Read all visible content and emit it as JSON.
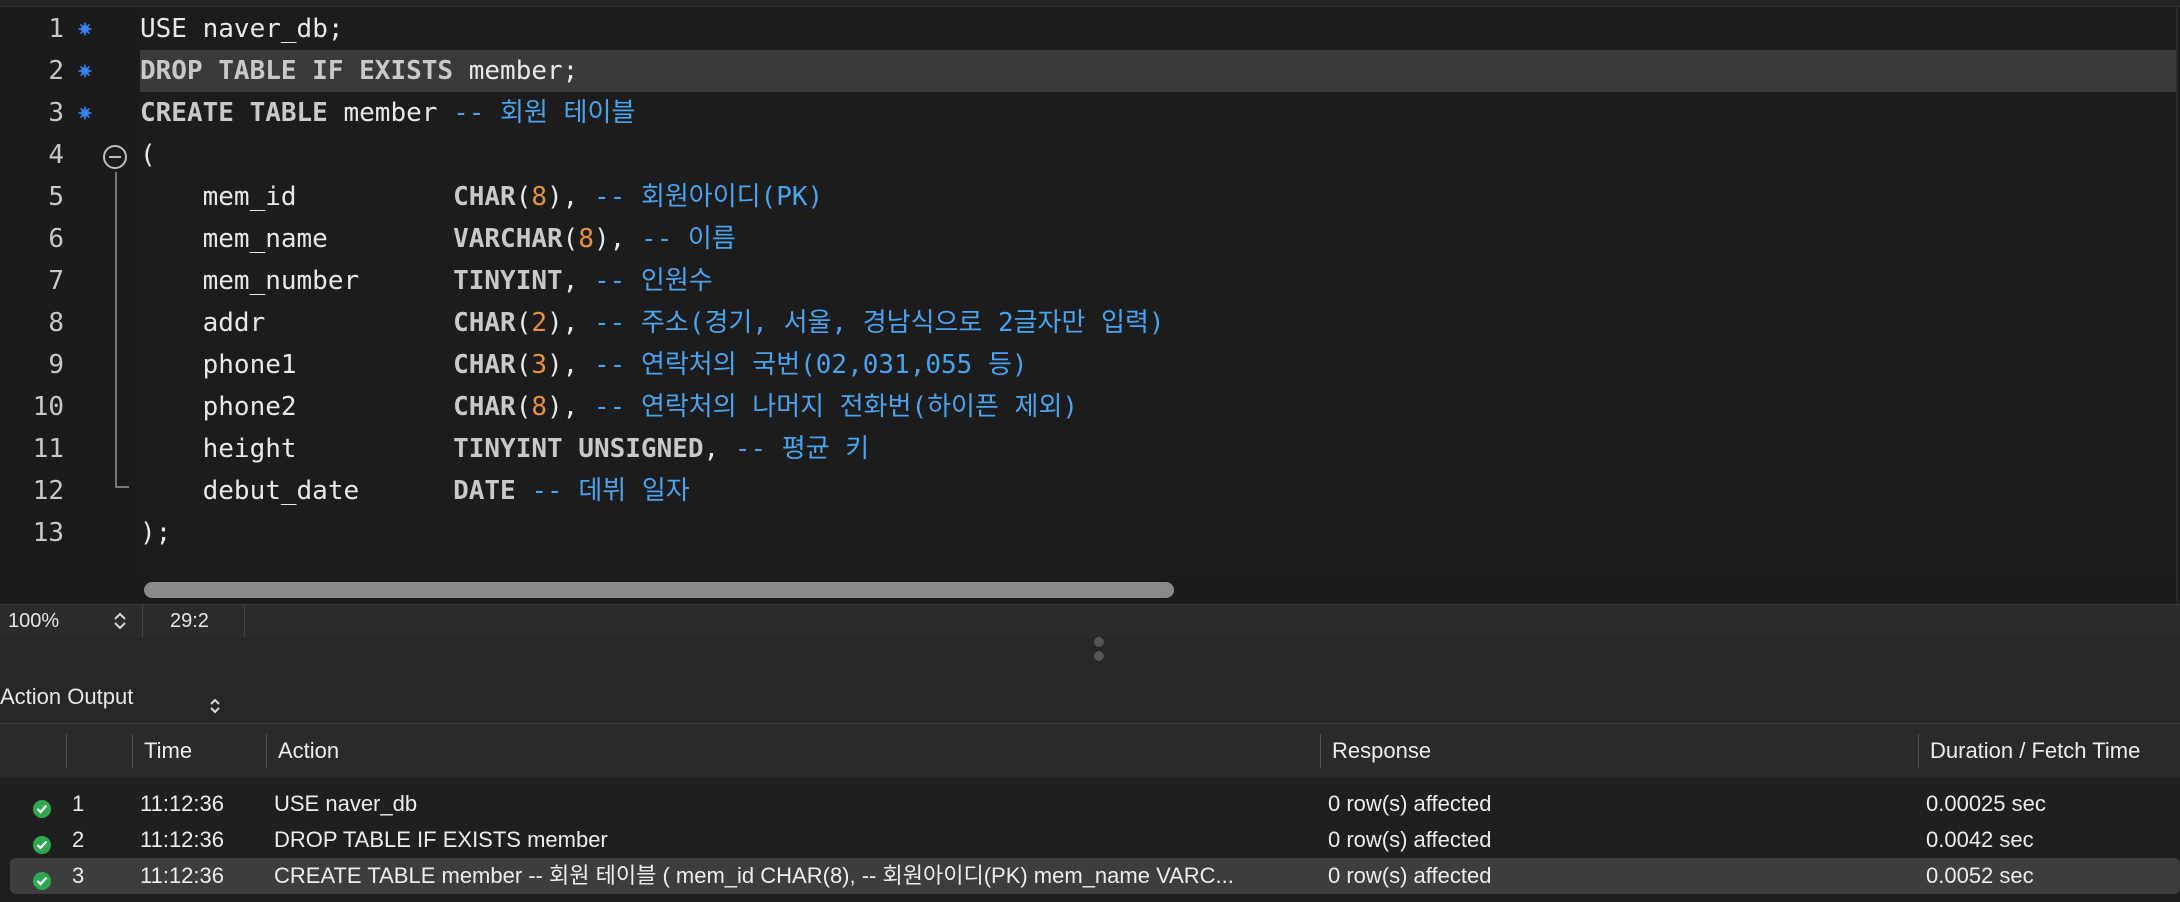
{
  "editor": {
    "lines": [
      {
        "num": "1",
        "modified": true,
        "tokens": [
          {
            "t": "USE",
            "c": "tx"
          },
          {
            "t": " naver_db;",
            "c": "tx"
          }
        ]
      },
      {
        "num": "2",
        "modified": true,
        "highlight": true,
        "tokens": [
          {
            "t": "DROP TABLE IF EXISTS",
            "c": "kw"
          },
          {
            "t": " member;",
            "c": "tx"
          }
        ]
      },
      {
        "num": "3",
        "modified": true,
        "tokens": [
          {
            "t": "CREATE TABLE",
            "c": "kw"
          },
          {
            "t": " member ",
            "c": "tx"
          },
          {
            "t": "-- 회원 테이블",
            "c": "cm"
          }
        ]
      },
      {
        "num": "4",
        "modified": false,
        "tokens": [
          {
            "t": "(",
            "c": "tx"
          }
        ]
      },
      {
        "num": "5",
        "modified": false,
        "tokens": [
          {
            "t": "    mem_id          ",
            "c": "tx"
          },
          {
            "t": "CHAR",
            "c": "kw"
          },
          {
            "t": "(",
            "c": "tx"
          },
          {
            "t": "8",
            "c": "num"
          },
          {
            "t": "), ",
            "c": "tx"
          },
          {
            "t": "-- 회원아이디(PK)",
            "c": "cm"
          }
        ]
      },
      {
        "num": "6",
        "modified": false,
        "tokens": [
          {
            "t": "    mem_name        ",
            "c": "tx"
          },
          {
            "t": "VARCHAR",
            "c": "kw"
          },
          {
            "t": "(",
            "c": "tx"
          },
          {
            "t": "8",
            "c": "num"
          },
          {
            "t": "), ",
            "c": "tx"
          },
          {
            "t": "-- 이름",
            "c": "cm"
          }
        ]
      },
      {
        "num": "7",
        "modified": false,
        "tokens": [
          {
            "t": "    mem_number      ",
            "c": "tx"
          },
          {
            "t": "TINYINT",
            "c": "kw"
          },
          {
            "t": ", ",
            "c": "tx"
          },
          {
            "t": "-- 인원수",
            "c": "cm"
          }
        ]
      },
      {
        "num": "8",
        "modified": false,
        "tokens": [
          {
            "t": "    addr            ",
            "c": "tx"
          },
          {
            "t": "CHAR",
            "c": "kw"
          },
          {
            "t": "(",
            "c": "tx"
          },
          {
            "t": "2",
            "c": "num"
          },
          {
            "t": "), ",
            "c": "tx"
          },
          {
            "t": "-- 주소(경기, 서울, 경남식으로 2글자만 입력)",
            "c": "cm"
          }
        ]
      },
      {
        "num": "9",
        "modified": false,
        "tokens": [
          {
            "t": "    phone1          ",
            "c": "tx"
          },
          {
            "t": "CHAR",
            "c": "kw"
          },
          {
            "t": "(",
            "c": "tx"
          },
          {
            "t": "3",
            "c": "num"
          },
          {
            "t": "), ",
            "c": "tx"
          },
          {
            "t": "-- 연락처의 국번(02,031,055 등)",
            "c": "cm"
          }
        ]
      },
      {
        "num": "10",
        "modified": false,
        "tokens": [
          {
            "t": "    phone2          ",
            "c": "tx"
          },
          {
            "t": "CHAR",
            "c": "kw"
          },
          {
            "t": "(",
            "c": "tx"
          },
          {
            "t": "8",
            "c": "num"
          },
          {
            "t": "), ",
            "c": "tx"
          },
          {
            "t": "-- 연락처의 나머지 전화번(하이픈 제외)",
            "c": "cm"
          }
        ]
      },
      {
        "num": "11",
        "modified": false,
        "tokens": [
          {
            "t": "    height          ",
            "c": "tx"
          },
          {
            "t": "TINYINT UNSIGNED",
            "c": "kw"
          },
          {
            "t": ", ",
            "c": "tx"
          },
          {
            "t": "-- 평균 키",
            "c": "cm"
          }
        ]
      },
      {
        "num": "12",
        "modified": false,
        "tokens": [
          {
            "t": "    debut_date      ",
            "c": "tx"
          },
          {
            "t": "DATE",
            "c": "kw"
          },
          {
            "t": " ",
            "c": "tx"
          },
          {
            "t": "-- 데뷔 일자",
            "c": "cm"
          }
        ]
      },
      {
        "num": "13",
        "modified": false,
        "tokens": [
          {
            "t": ");",
            "c": "tx"
          }
        ]
      }
    ]
  },
  "statusbar": {
    "zoom": "100%",
    "cursor_position": "29:2"
  },
  "output": {
    "title": "Action Output",
    "columns": {
      "time": "Time",
      "action": "Action",
      "response": "Response",
      "duration": "Duration / Fetch Time"
    },
    "rows": [
      {
        "index": "1",
        "time": "11:12:36",
        "action": "USE naver_db",
        "response": "0 row(s) affected",
        "duration": "0.00025 sec"
      },
      {
        "index": "2",
        "time": "11:12:36",
        "action": "DROP TABLE IF EXISTS member",
        "response": "0 row(s) affected",
        "duration": "0.0042 sec"
      },
      {
        "index": "3",
        "time": "11:12:36",
        "action": "CREATE TABLE member -- 회원 테이블 (  mem_id   CHAR(8), -- 회원아이디(PK)     mem_name  VARC...",
        "response": "0 row(s) affected",
        "duration": "0.0052 sec",
        "selected": true
      }
    ]
  },
  "colors": {
    "keyword": "#c9c9c9",
    "number": "#e8913a",
    "comment": "#4aa3ee",
    "success_icon": "#2fa84f",
    "modified_dot": "#3b82f6"
  },
  "icons": {
    "modified_marker": "blue-asterisk-icon",
    "fold": "collapse-circle-icon",
    "zoom_stepper": "up-down-chevron-icon",
    "output_selector": "up-down-chevron-icon",
    "row_status": "green-checkmark-icon"
  }
}
